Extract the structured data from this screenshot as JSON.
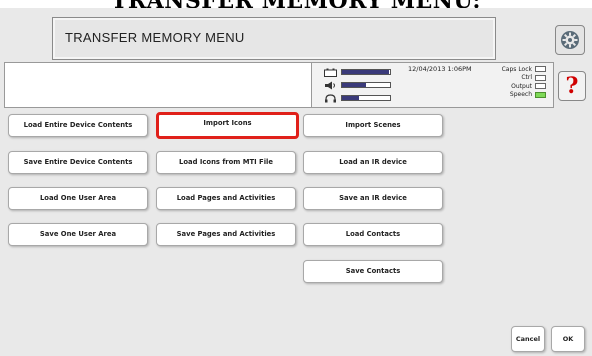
{
  "heading": "TRANSFER MEMORY MENU:",
  "title_bar": {
    "title": "TRANSFER MEMORY MENU"
  },
  "status": {
    "datetime": "12/04/2013 1:06PM",
    "indicators": [
      {
        "label": "Caps Lock",
        "on": false
      },
      {
        "label": "Ctrl",
        "on": false
      },
      {
        "label": "Output",
        "on": false
      },
      {
        "label": "Speech",
        "on": true
      }
    ],
    "meters": [
      {
        "icon": "battery-icon",
        "level": 0.98
      },
      {
        "icon": "speaker-icon",
        "level": 0.5
      },
      {
        "icon": "headphones-icon",
        "level": 0.35
      }
    ]
  },
  "help_label": "?",
  "menu": {
    "col1": [
      "Load Entire Device Contents",
      "Save Entire Device Contents",
      "Load One User Area",
      "Save One User Area"
    ],
    "col2": [
      "Import Icons",
      "Load Icons from MTI File",
      "Load Pages and Activities",
      "Save Pages and Activities"
    ],
    "col3": [
      "Import Scenes",
      "Load an IR device",
      "Save an IR device",
      "Load Contacts",
      "Save Contacts"
    ],
    "selected": "Import Icons"
  },
  "footer": {
    "cancel": "Cancel",
    "ok": "OK"
  },
  "colors": {
    "selected_border": "#e0201a",
    "speech_on": "#7ed957",
    "help": "#d00000"
  }
}
